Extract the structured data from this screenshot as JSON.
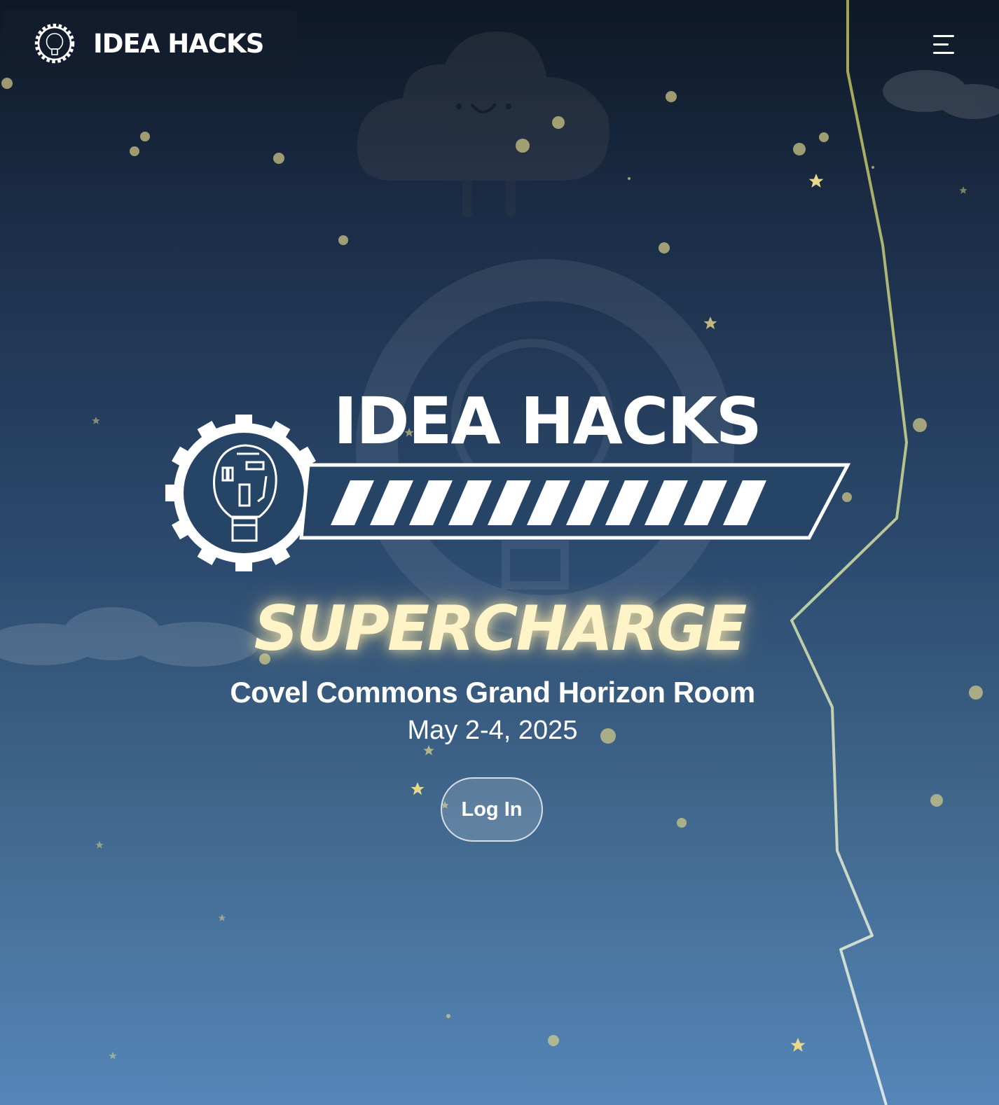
{
  "header": {
    "brand_name": "IDEA HACKS",
    "logo_icon": "lightbulb-gear-icon",
    "menu_icon": "hamburger-menu-icon"
  },
  "hero": {
    "title": "IDEA HACKS",
    "theme": "SUPERCHARGE",
    "venue": "Covel Commons Grand Horizon Room",
    "dates": "May 2-4, 2025",
    "login_label": "Log In"
  },
  "decorations": {
    "cloud_mascot": "smiling-cloud",
    "lightning": "lightning-bolt",
    "stars": "star-icons"
  },
  "colors": {
    "background_top": "#0e1825",
    "background_bottom": "#5486b8",
    "theme_glow": "#fff3c8",
    "lightning": "#c8c878",
    "star": "#e8d98a"
  }
}
